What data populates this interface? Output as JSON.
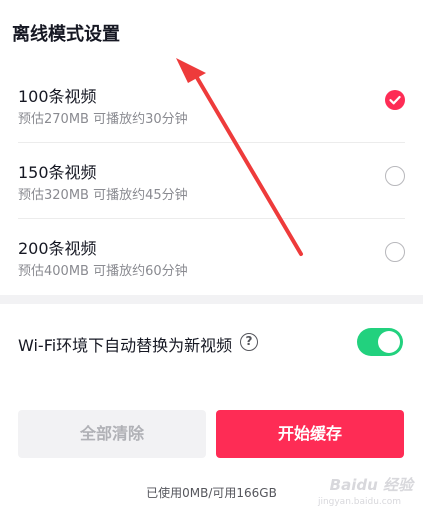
{
  "title": "离线模式设置",
  "options": [
    {
      "name": "100条视频",
      "desc": "预估270MB 可播放约30分钟",
      "selected": true
    },
    {
      "name": "150条视频",
      "desc": "预估320MB 可播放约45分钟",
      "selected": false
    },
    {
      "name": "200条视频",
      "desc": "预估400MB 可播放约60分钟",
      "selected": false
    }
  ],
  "wifi": {
    "label": "Wi-Fi环境下自动替换为新视频",
    "help_icon": "?",
    "toggle_on": true
  },
  "buttons": {
    "clear_label": "全部清除",
    "start_label": "开始缓存"
  },
  "storage_text": "已使用0MB/可用166GB",
  "watermark": {
    "brand": "Baidu 经验",
    "url": "jingyan.baidu.com"
  },
  "colors": {
    "accent": "#fe2c55",
    "toggle": "#22d17e",
    "arrow": "#ee3b3b"
  }
}
